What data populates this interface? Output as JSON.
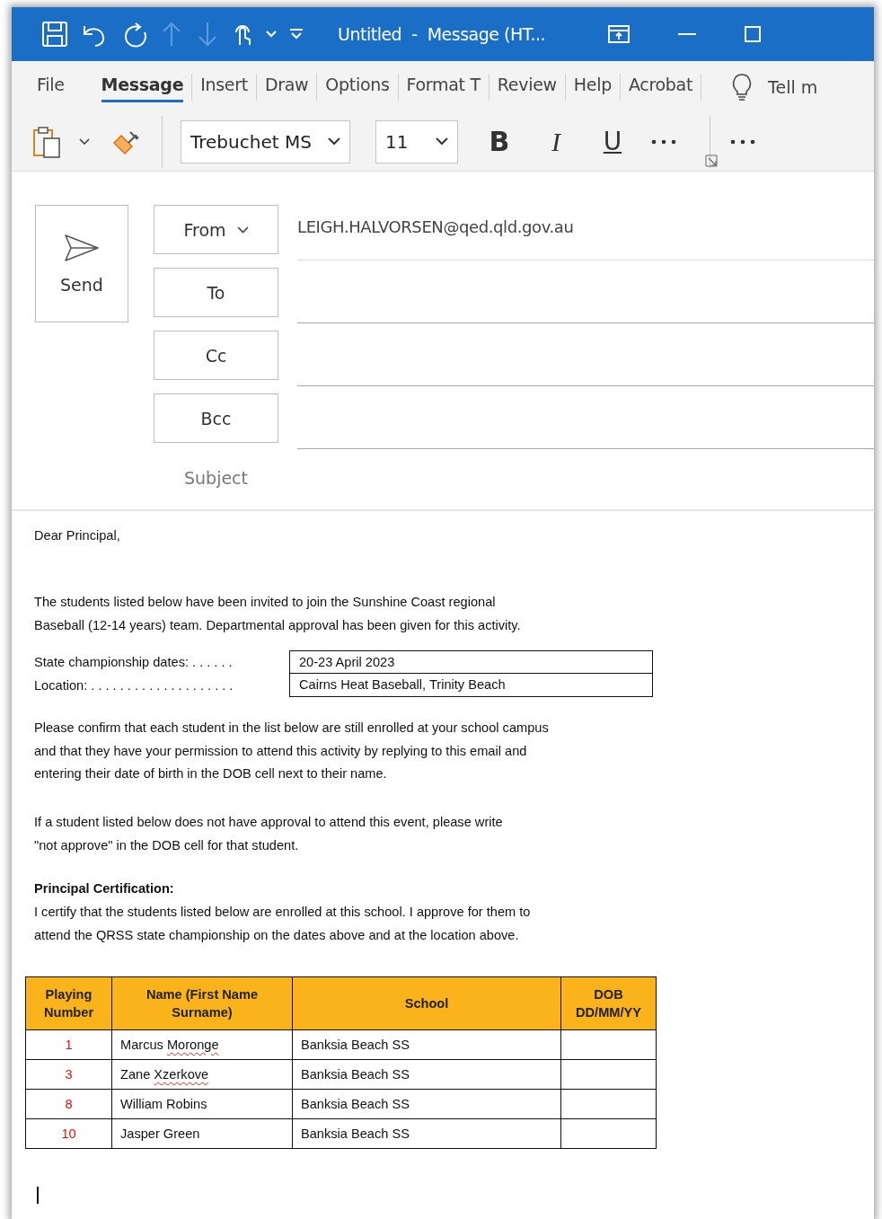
{
  "window": {
    "title": "Untitled  -  Message (HT..."
  },
  "ribbon_tabs": [
    {
      "label": "File",
      "selected": false
    },
    {
      "label": "Message",
      "selected": true
    },
    {
      "label": "Insert",
      "selected": false
    },
    {
      "label": "Draw",
      "selected": false
    },
    {
      "label": "Options",
      "selected": false
    },
    {
      "label": "Format T",
      "selected": false
    },
    {
      "label": "Review",
      "selected": false
    },
    {
      "label": "Help",
      "selected": false
    },
    {
      "label": "Acrobat",
      "selected": false
    }
  ],
  "tell_me": "Tell m",
  "toolbar": {
    "font": "Trebuchet MS",
    "size": "11",
    "format_buttons": [
      {
        "label": "B",
        "kind": "bold"
      },
      {
        "label": "I",
        "kind": "italic"
      },
      {
        "label": "U",
        "kind": "underline"
      }
    ]
  },
  "header": {
    "send": "Send",
    "fields": [
      {
        "label": "From",
        "kind": "dropdown",
        "value": "LEIGH.HALVORSEN@qed.qld.gov.au"
      },
      {
        "label": "To",
        "kind": "button"
      },
      {
        "label": "Cc",
        "kind": "button"
      },
      {
        "label": "Bcc",
        "kind": "button"
      }
    ],
    "subject_label": "Subject"
  },
  "body": {
    "greeting": "Dear Principal,",
    "intro": [
      "The students listed below have been invited to join the Sunshine Coast regional",
      "Baseball (12-14 years) team.  Departmental approval has been given for this activity."
    ],
    "details": [
      {
        "label": "State championship dates: . . . . . .",
        "value": "20-23 April 2023"
      },
      {
        "label": "Location: . . . . . . . . . . . . . . . . . . . .",
        "value": "Cairns Heat Baseball, Trinity Beach"
      }
    ],
    "request": [
      "Please confirm that each student in the list below are still enrolled at your school campus",
      "and that they have your permission to attend this activity by replying to this email and",
      "entering their date of birth in the DOB cell next to their name."
    ],
    "refusal": [
      "If a student listed below does not have approval to attend this event, please write",
      "\"not approve\" in the DOB cell for that student."
    ],
    "certification_heading": "Principal Certification:",
    "certification": [
      "I certify that the students listed below are enrolled at this school.  I approve for them to",
      "attend the QRSS state championship on the dates above and at the location above."
    ],
    "students": {
      "columns": [
        [
          "Playing",
          "Number"
        ],
        [
          "Name (First Name",
          "Surname)"
        ],
        [
          "School"
        ],
        [
          "DOB",
          "DD/MM/YY"
        ]
      ],
      "rows": [
        {
          "number": "1",
          "name": "Marcus Moronge",
          "misspelled": true,
          "school": "Banksia Beach SS"
        },
        {
          "number": "3",
          "name": "Zane Xzerkove",
          "misspelled": true,
          "school": "Banksia Beach SS"
        },
        {
          "number": "8",
          "name": "William Robins",
          "misspelled": false,
          "school": "Banksia Beach SS"
        },
        {
          "number": "10",
          "name": "Jasper Green",
          "misspelled": false,
          "school": "Banksia Beach SS"
        }
      ]
    }
  }
}
